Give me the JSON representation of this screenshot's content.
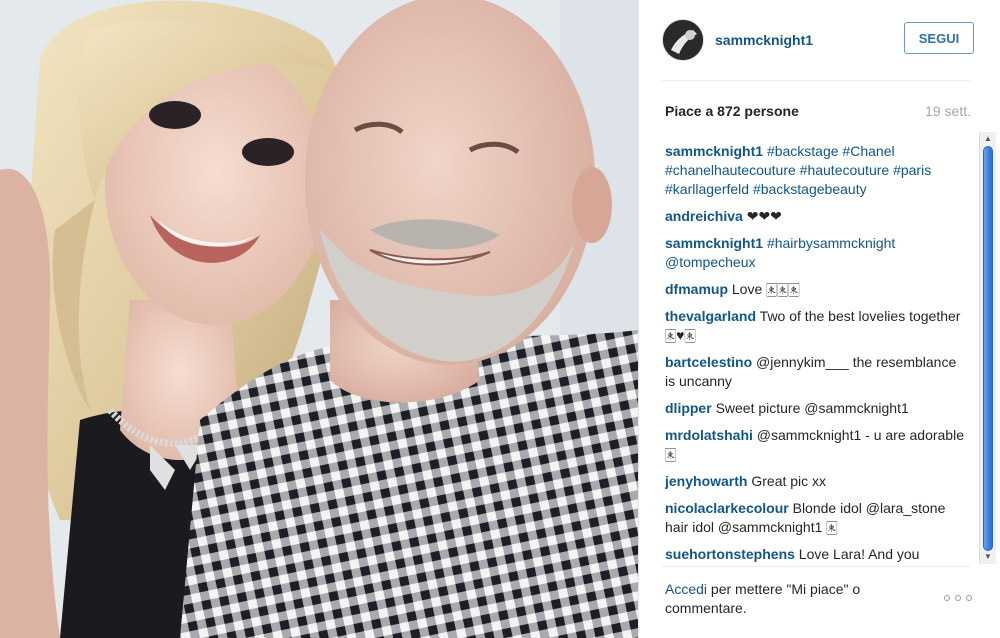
{
  "post": {
    "username": "sammcknight1",
    "follow_label": "SEGUI",
    "likes_text": "Piace a 872 persone",
    "age": "19 sett."
  },
  "comments": [
    {
      "user": "sammcknight1",
      "text": "#backstage #Chanel #chanelhautecouture #hautecouture #paris #karllagerfeld #backstagebeauty"
    },
    {
      "user": "andreichiva",
      "text": "❤❤❤"
    },
    {
      "user": "sammcknight1",
      "text": "#hairbysammcknight @tompecheux"
    },
    {
      "user": "dfmamup",
      "text": "Love 🀀🀀🀀"
    },
    {
      "user": "thevalgarland",
      "text": "Two of the best lovelies together 🀀♥🀀"
    },
    {
      "user": "bartcelestino",
      "text": "@jennykim___ the resemblance is uncanny"
    },
    {
      "user": "dlipper",
      "text": "Sweet picture @sammcknight1"
    },
    {
      "user": "mrdolatshahi",
      "text": "@sammcknight1 - u are adorable 🀀"
    },
    {
      "user": "jenyhowarth",
      "text": "Great pic xx"
    },
    {
      "user": "nicolaclarkecolour",
      "text": "Blonde idol @lara_stone hair idol @sammcknight1 🀀"
    },
    {
      "user": "suehortonstephens",
      "text": "Love Lara! And you"
    }
  ],
  "footer": {
    "login_link": "Accedi",
    "rest": " per mettere \"Mi piace\" o commentare."
  },
  "colors": {
    "link": "#125688",
    "follow_border": "#6f97b6",
    "muted": "#a5a7aa"
  },
  "icons": {
    "more": "ellipsis-icon",
    "avatar": "user-avatar"
  }
}
